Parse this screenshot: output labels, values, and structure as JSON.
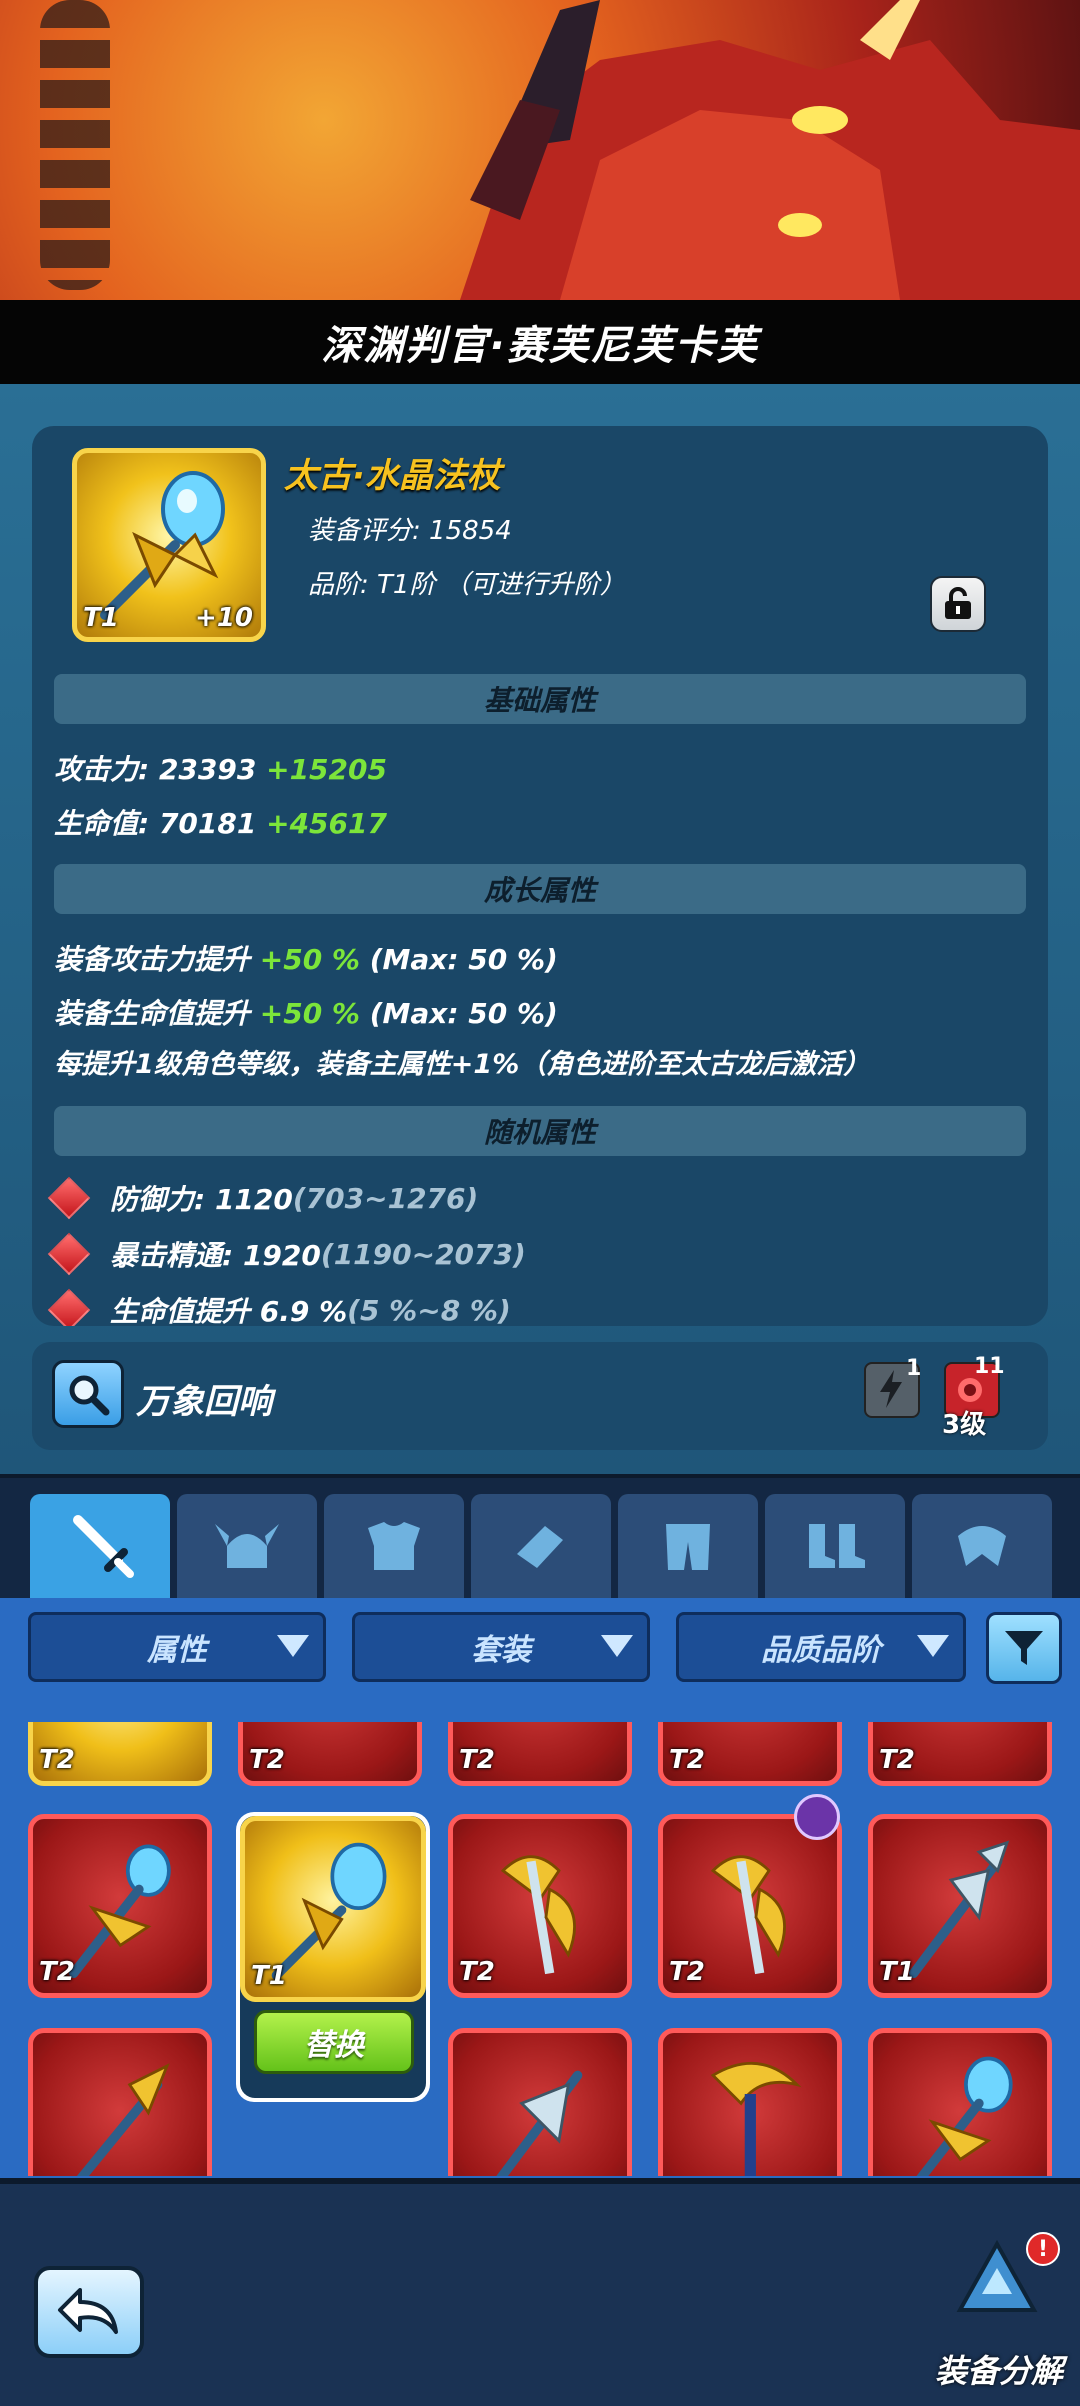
{
  "hero": {
    "title": "深渊判官·赛芙尼芙卡芙"
  },
  "item": {
    "name": "太古·水晶法杖",
    "tier_badge": "T1",
    "enhance_badge": "+10",
    "score_label": "装备评分: 15854",
    "grade_label": "品阶: T1阶 （可进行升阶）"
  },
  "sections": {
    "base": "基础属性",
    "growth": "成长属性",
    "random": "随机属性"
  },
  "base_attrs": [
    {
      "label": "攻击力: 23393 ",
      "bonus": "+15205"
    },
    {
      "label": "生命值: 70181 ",
      "bonus": "+45617"
    }
  ],
  "growth_attrs": [
    {
      "label": "装备攻击力提升 ",
      "bonus": "+50 %",
      "max": " (Max: 50 %)"
    },
    {
      "label": "装备生命值提升 ",
      "bonus": "+50 %",
      "max": " (Max: 50 %)"
    }
  ],
  "growth_note": "每提升1级角色等级，装备主属性+1%（角色进阶至太古龙后激活）",
  "random_attrs": [
    {
      "label": "防御力: 1120 ",
      "range": "(703~1276)"
    },
    {
      "label": "暴击精通: 1920 ",
      "range": "(1190~2073)"
    },
    {
      "label": "生命值提升 6.9 % ",
      "range": "(5 %~8 %)"
    }
  ],
  "echo": {
    "label": "万象回响",
    "skill_a_count": "1",
    "skill_b_count": "11",
    "skill_b_level": "3级"
  },
  "tabs": [
    {
      "name": "weapon",
      "icon": "sword-icon"
    },
    {
      "name": "helmet",
      "icon": "horned-helmet-icon"
    },
    {
      "name": "armor",
      "icon": "chest-armor-icon"
    },
    {
      "name": "bracer",
      "icon": "bracer-icon"
    },
    {
      "name": "pants",
      "icon": "pants-icon"
    },
    {
      "name": "boots",
      "icon": "boots-icon"
    },
    {
      "name": "accessory",
      "icon": "accessory-icon"
    }
  ],
  "filters": {
    "attribute": "属性",
    "set": "套装",
    "quality": "品质品阶"
  },
  "grid": {
    "row0": [
      "T2",
      "T2",
      "T2",
      "T2",
      "T2"
    ],
    "row1": [
      "T2",
      "T1",
      "T2",
      "T2",
      "T1"
    ],
    "replace_label": "替换"
  },
  "bottom": {
    "decompose_label": "装备分解",
    "decompose_badge": "!"
  },
  "colors": {
    "gold": "#f7c21f",
    "bonus_green": "#7ce53a",
    "rare_red": "#c7232a",
    "accent_blue": "#3aa2e4"
  }
}
